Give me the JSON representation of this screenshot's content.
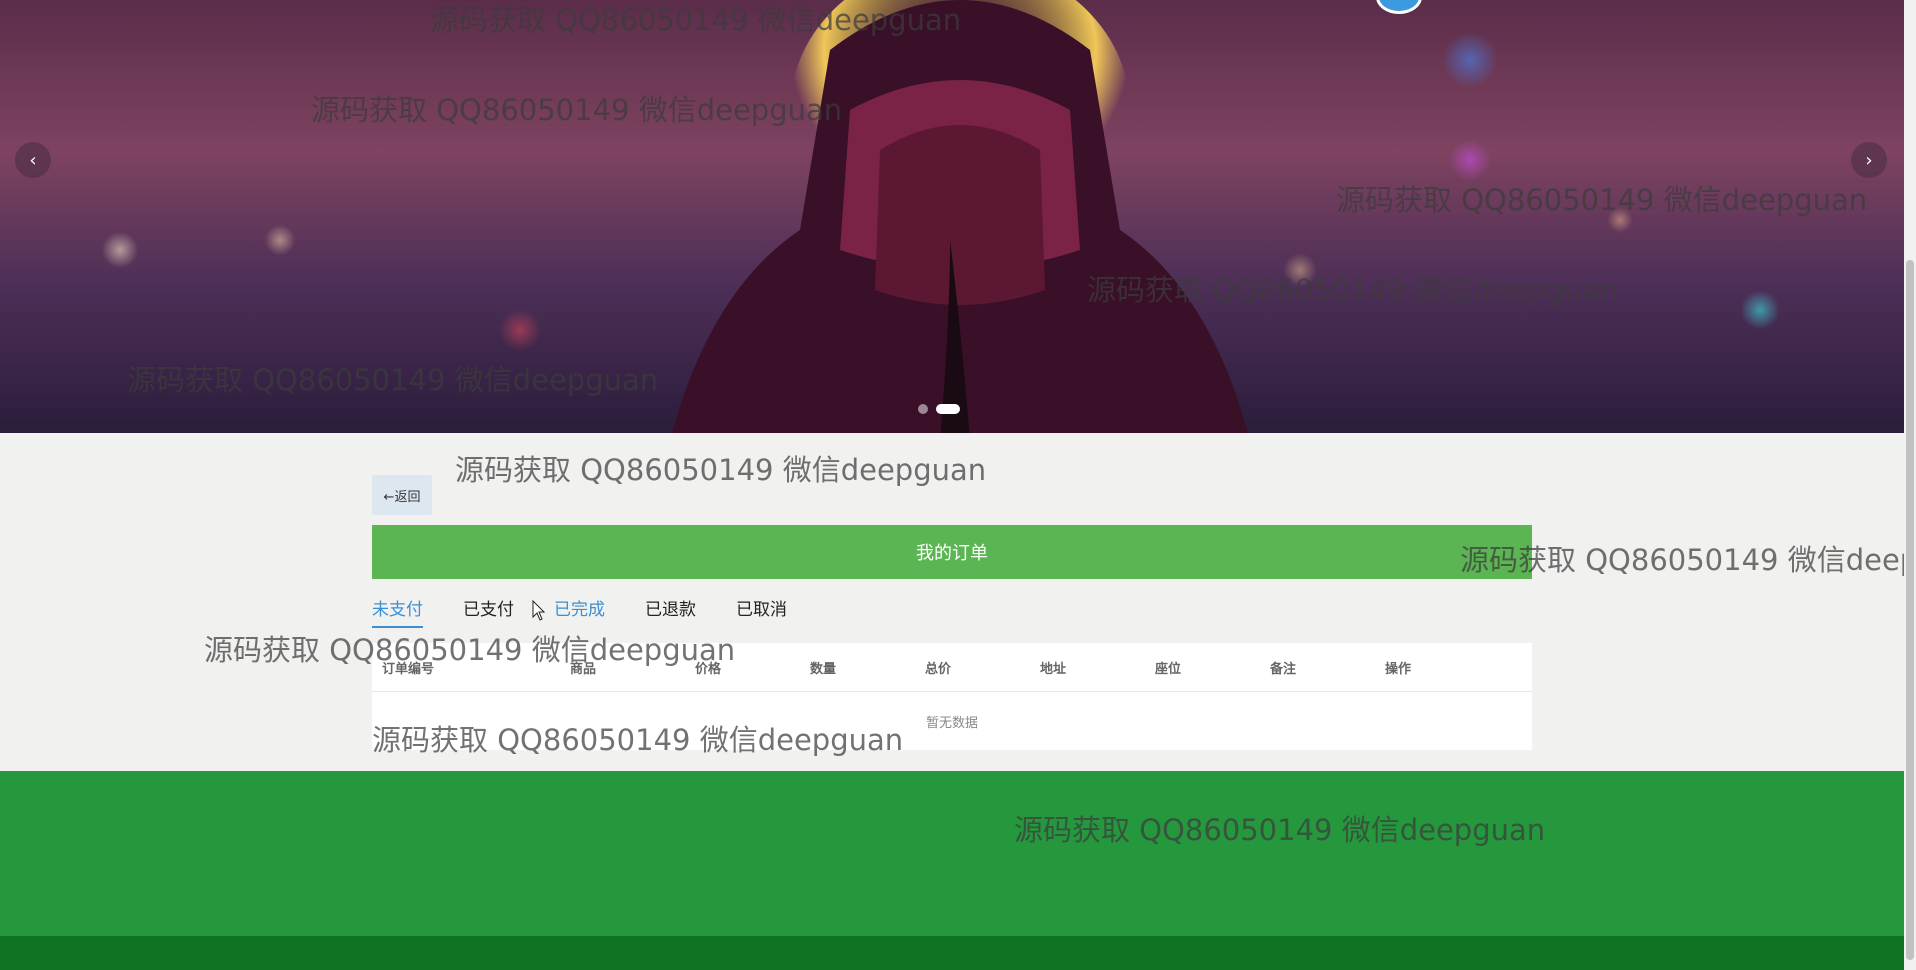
{
  "carousel": {
    "prev_icon": "‹",
    "next_icon": "›",
    "slide_count": 2,
    "active_slide": 2
  },
  "back_button": {
    "label": "←返回"
  },
  "orders": {
    "title": "我的订单",
    "tabs": [
      "未支付",
      "已支付",
      "已完成",
      "已退款",
      "已取消"
    ],
    "active_tab": "未支付",
    "columns": [
      "订单编号",
      "商品",
      "价格",
      "数量",
      "总价",
      "地址",
      "座位",
      "备注",
      "操作"
    ],
    "empty_text": "暂无数据"
  },
  "watermark": "源码获取 QQ86050149 微信deepguan",
  "colors": {
    "header_green": "#5bb552",
    "footer_green": "#25983d",
    "footer_dark": "#0f7220",
    "active_tab": "#3b8fd4"
  }
}
